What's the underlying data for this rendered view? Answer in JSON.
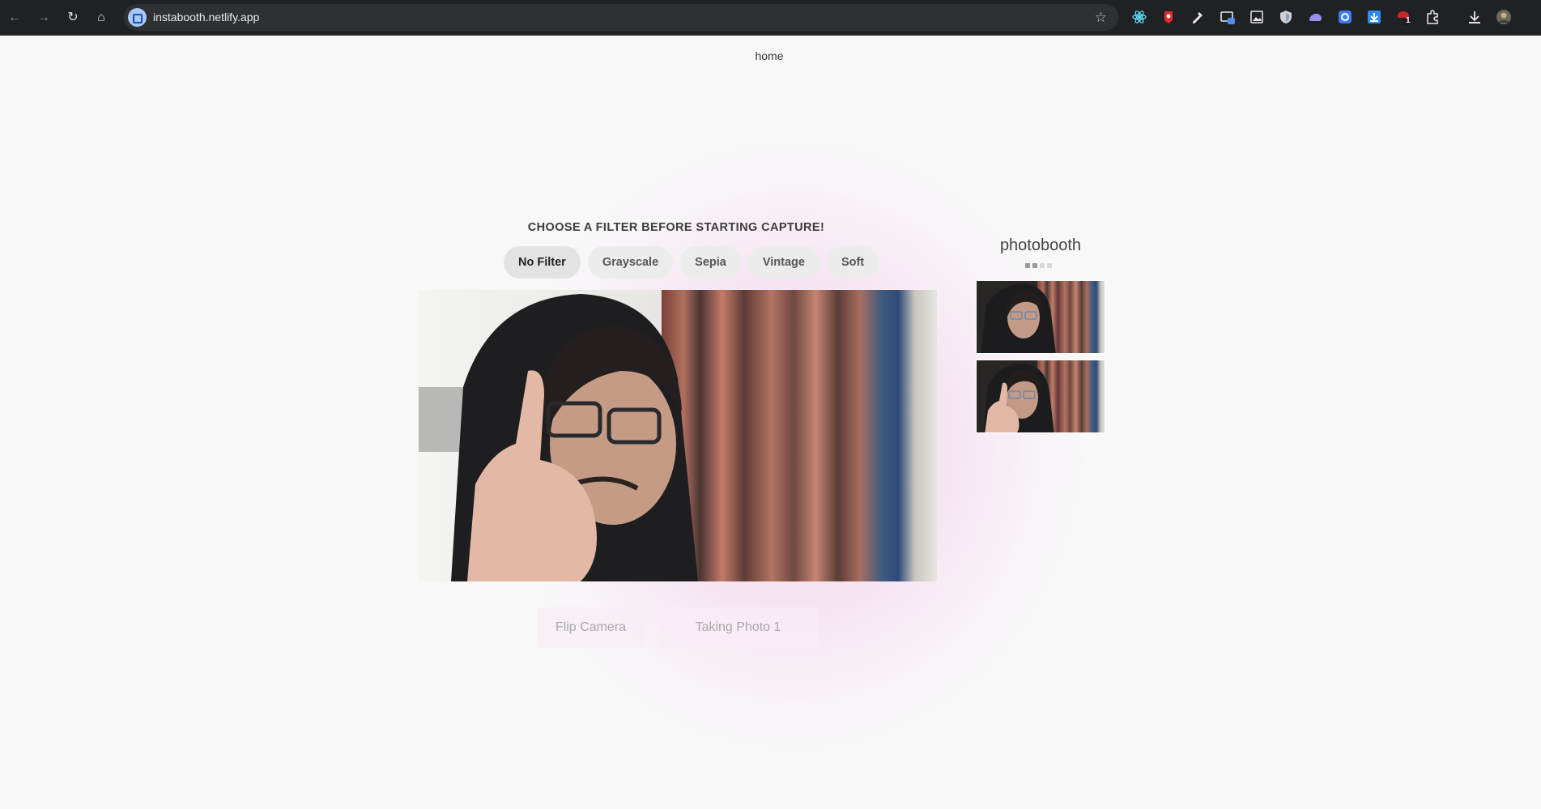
{
  "browser": {
    "url": "instabooth.netlify.app",
    "extension_icons": [
      "react-devtools-icon",
      "red-extension-icon",
      "eyedropper-icon",
      "window-extension-icon",
      "image-icon",
      "shield-icon",
      "cloud-icon",
      "circle-extension-icon",
      "download-extension-icon",
      "badge-extension-icon",
      "puzzle-icon"
    ],
    "extension_badge": "1"
  },
  "page": {
    "home_link": "home",
    "filter_heading": "CHOOSE A FILTER BEFORE STARTING CAPTURE!",
    "filters": [
      "No Filter",
      "Grayscale",
      "Sepia",
      "Vintage",
      "Soft"
    ],
    "selected_filter": "No Filter",
    "controls": {
      "flip_label": "Flip Camera",
      "capture_label": "Taking Photo 1"
    },
    "strip": {
      "title": "photobooth",
      "photos_taken": 2,
      "total_slots": 4
    }
  },
  "colors": {
    "accent_glow": "#f4c8e8",
    "page_bg": "#f8f8f8",
    "chrome_bg": "#202124"
  }
}
